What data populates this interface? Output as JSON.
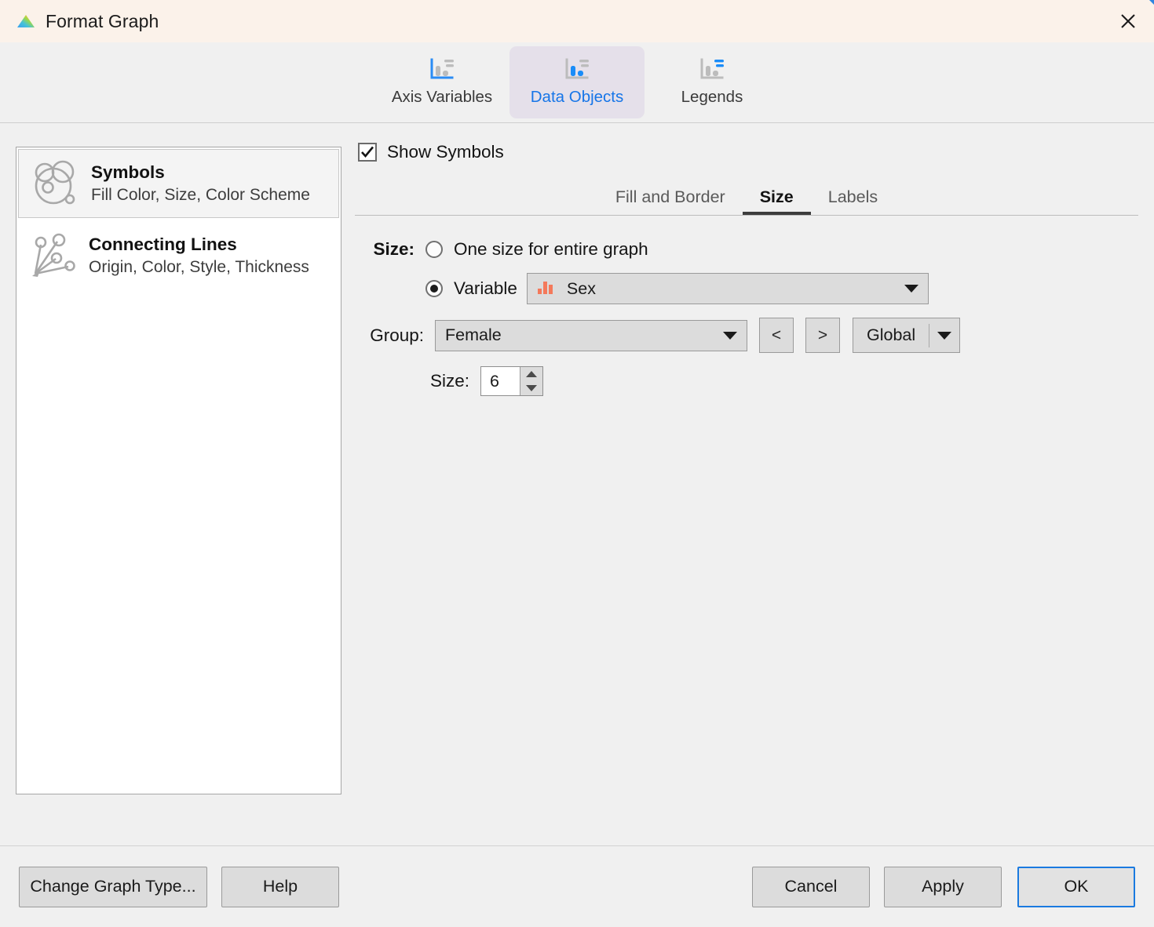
{
  "window": {
    "title": "Format Graph",
    "logo_icon": "graphpad-prism-logo-icon",
    "close_icon": "close-icon"
  },
  "tabs": [
    {
      "label": "Axis Variables",
      "icon": "axis-variables-chart-icon",
      "active": false
    },
    {
      "label": "Data Objects",
      "icon": "data-objects-chart-icon",
      "active": true
    },
    {
      "label": "Legends",
      "icon": "legends-chart-icon",
      "active": false
    }
  ],
  "sidebar": {
    "items": [
      {
        "title": "Symbols",
        "subtitle": "Fill Color, Size, Color Scheme",
        "icon": "symbols-circles-icon",
        "selected": true
      },
      {
        "title": "Connecting Lines",
        "subtitle": "Origin, Color, Style, Thickness",
        "icon": "connecting-lines-icon",
        "selected": false
      }
    ]
  },
  "panel": {
    "show_symbols": {
      "label": "Show Symbols",
      "checked": true
    },
    "subtabs": [
      {
        "label": "Fill and Border",
        "active": false
      },
      {
        "label": "Size",
        "active": true
      },
      {
        "label": "Labels",
        "active": false
      }
    ],
    "size_section": {
      "lead_label": "Size:",
      "option_one_size": {
        "label": "One size for entire graph",
        "selected": false
      },
      "option_variable": {
        "label": "Variable",
        "selected": true,
        "variable_value": "Sex",
        "variable_icon": "bar-chart-variable-icon",
        "dropdown_icon": "chevron-down-icon"
      },
      "group_row": {
        "label": "Group:",
        "value": "Female",
        "dropdown_icon": "chevron-down-icon",
        "prev_label": "<",
        "next_label": ">",
        "scope_label": "Global",
        "scope_dropdown_icon": "chevron-down-icon"
      },
      "size_row": {
        "label": "Size:",
        "value": "6",
        "stepper_up_icon": "triangle-up-icon",
        "stepper_down_icon": "triangle-down-icon"
      }
    }
  },
  "footer": {
    "change_graph_type": "Change Graph Type...",
    "help": "Help",
    "cancel": "Cancel",
    "apply": "Apply",
    "ok": "OK"
  },
  "colors": {
    "accent_blue": "#1675e8",
    "titlebar_bg": "#fbf2ea",
    "dialog_bg": "#f0f0f0",
    "active_tab_bg": "#e5e0ea",
    "variable_icon_orange": "#f4795b"
  }
}
